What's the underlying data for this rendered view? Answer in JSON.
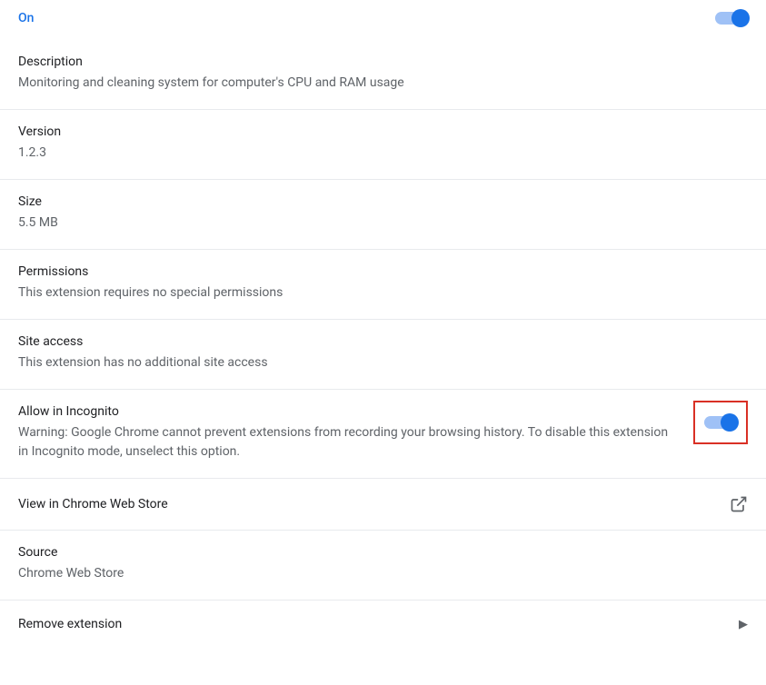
{
  "on": {
    "label": "On"
  },
  "description": {
    "title": "Description",
    "value": "Monitoring and cleaning system for computer's CPU and RAM usage"
  },
  "version": {
    "title": "Version",
    "value": "1.2.3"
  },
  "size": {
    "title": "Size",
    "value": "5.5 MB"
  },
  "permissions": {
    "title": "Permissions",
    "value": "This extension requires no special permissions"
  },
  "site_access": {
    "title": "Site access",
    "value": "This extension has no additional site access"
  },
  "incognito": {
    "title": "Allow in Incognito",
    "value": "Warning: Google Chrome cannot prevent extensions from recording your browsing history. To disable this extension in Incognito mode, unselect this option."
  },
  "webstore": {
    "title": "View in Chrome Web Store"
  },
  "source": {
    "title": "Source",
    "value": "Chrome Web Store"
  },
  "remove": {
    "title": "Remove extension"
  }
}
